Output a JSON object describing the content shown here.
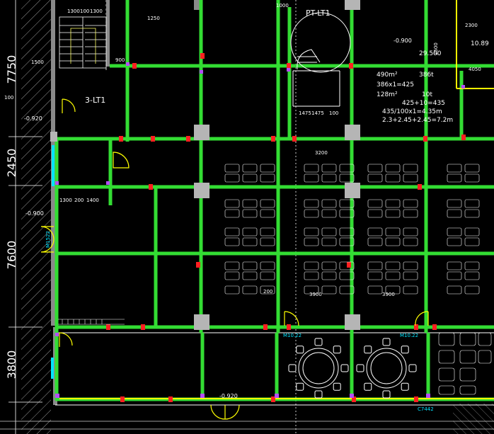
{
  "drawing": {
    "dim_left": [
      "7750",
      "2450",
      "7600",
      "3800"
    ],
    "stair_tag": "3-LT1",
    "pt_tag": "PT-LT1",
    "stair_dims_top": [
      "1300",
      "100",
      "1300"
    ],
    "stair_dims_mid": [
      "1300",
      "200",
      "1400"
    ],
    "stair_dims_pt": [
      "1475",
      "1475",
      "100"
    ],
    "span_labels": [
      "3200",
      "3900",
      "3900"
    ],
    "small_200": "200",
    "level_left": "-0.920",
    "level_mid": "-0.900",
    "level_bottom": "-0.920",
    "level_right": "-0.900",
    "level_right2": "29.500",
    "level_right3": "10.89",
    "door_m1022": "M10.22",
    "door_m1522": "M1522",
    "door_c7442": "C7442",
    "stats": [
      {
        "left": "490m²",
        "right": "386t"
      },
      {
        "left": "386x1=425",
        "right": ""
      },
      {
        "left": "128m²",
        "right": "10t"
      },
      {
        "left": "425+10=435",
        "right": ""
      },
      {
        "left": "435/100x1=4.35m",
        "right": ""
      },
      {
        "left": "2.3+2.45+2.45=7.2m",
        "right": ""
      }
    ],
    "misc_nums": [
      "2300",
      "2500",
      "4050",
      "1000",
      "1500",
      "100",
      "900",
      "1250"
    ]
  }
}
